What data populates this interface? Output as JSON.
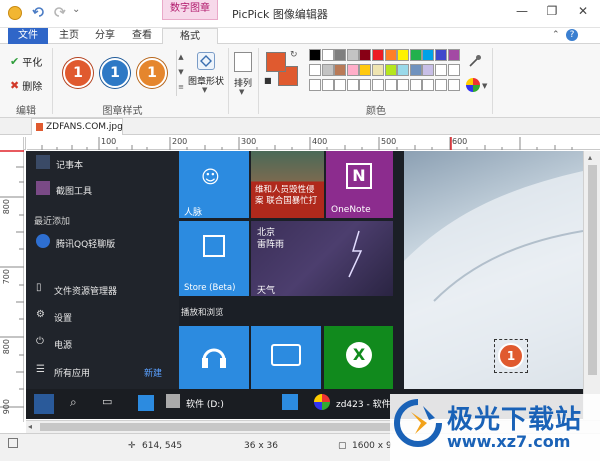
{
  "window": {
    "title": "PicPick 图像编辑器",
    "context_tab_header": "数字图章",
    "controls": {
      "minimize": "—",
      "restore": "❐",
      "close": "✕"
    }
  },
  "quick_access": {
    "undo_icon": "undo-icon",
    "redo_icon": "redo-icon",
    "dropdown": "⌄"
  },
  "tabs": [
    "文件",
    "主页",
    "分享",
    "查看",
    "格式"
  ],
  "ribbon": {
    "edit_group": {
      "label": "编辑",
      "flatten": "平化",
      "delete": "删除"
    },
    "stamp_style_group": {
      "label": "图章样式",
      "stamps": [
        {
          "text": "1",
          "color": "#e05a2f"
        },
        {
          "text": "1",
          "color": "#2e79c5"
        },
        {
          "text": "1",
          "color": "#e5862d"
        }
      ]
    },
    "shape_button": "图章形状",
    "arrange_button": "排列",
    "colors_group": {
      "label": "颜色",
      "primary": "#e05a2f",
      "secondary": "#e05a2f",
      "palette": [
        [
          "#000000",
          "#ffffff",
          "#7f7f7f",
          "#c3c3c3",
          "#880015",
          "#ed1c24",
          "#ff7f27",
          "#fff200",
          "#22b14c",
          "#00a2e8",
          "#3f48cc",
          "#a349a4"
        ],
        [
          "#ffffff",
          "#c3c3c3",
          "#b97a57",
          "#ffaec9",
          "#ffc90e",
          "#efe4b0",
          "#b5e61d",
          "#99d9ea",
          "#7092be",
          "#c8bfe7",
          "#ffffff",
          "#ffffff"
        ],
        [
          "#ffffff",
          "#ffffff",
          "#ffffff",
          "#ffffff",
          "#ffffff",
          "#ffffff",
          "#ffffff",
          "#ffffff",
          "#ffffff",
          "#ffffff",
          "#ffffff",
          "#ffffff"
        ]
      ]
    }
  },
  "document_tab": {
    "name": "ZDFANS.COM.jpg"
  },
  "rulers": {
    "horizontal": [
      "100",
      "200",
      "300",
      "400",
      "500",
      "600"
    ],
    "vertical": [
      "800",
      "700",
      "800",
      "900"
    ]
  },
  "canvas": {
    "start_menu": {
      "items": [
        "记事本",
        "截图工具"
      ],
      "recent_header": "最近添加",
      "recent_item": "腾讯QQ轻聊版",
      "bottom": [
        "文件资源管理器",
        "设置",
        "电源",
        "所有应用"
      ],
      "new_label": "新建"
    },
    "tiles": {
      "people": "人脉",
      "news_text": "维和人员毁性侵案 联合国暴忙打",
      "onenote": "OneNote",
      "store": "Store (Beta)",
      "weather_city": "北京",
      "weather_cond": "雷阵雨",
      "weather_label": "天气",
      "section": "播放和浏览"
    },
    "taskbar": {
      "drive": "软件 (D:)",
      "app": "zd423 - 软件"
    },
    "stamp_number": "1"
  },
  "status_bar": {
    "cursor": "614, 545",
    "selection": "36 x 36",
    "image_size": "1600 x 9"
  },
  "watermark": {
    "text": "极光下载站",
    "url": "www.xz7.com"
  }
}
